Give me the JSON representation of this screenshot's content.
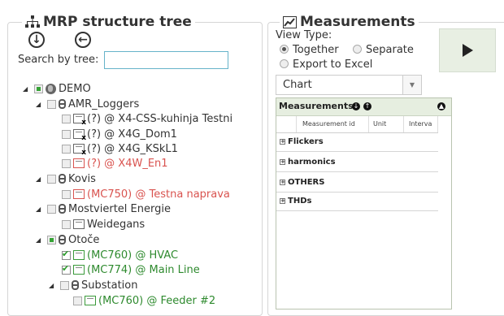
{
  "left_panel": {
    "title": "MRP structure tree",
    "search_label": "Search by tree:",
    "search_value": "",
    "tree": [
      {
        "label": "DEMO",
        "level": 0,
        "expanded": true,
        "checkbox": "partial",
        "icon": "globe-icon",
        "color": "normal"
      },
      {
        "label": "AMR_Loggers",
        "level": 1,
        "expanded": true,
        "checkbox": "none",
        "icon": "chain-icon",
        "color": "normal"
      },
      {
        "label": "(?) @ X4-CSS-kuhinja Testni",
        "level": 2,
        "checkbox": "none",
        "icon": "device-offline-icon",
        "color": "normal"
      },
      {
        "label": "(?) @ X4G_Dom1",
        "level": 2,
        "checkbox": "none",
        "icon": "device-offline-icon",
        "color": "normal"
      },
      {
        "label": "(?) @ X4G_KSkL1",
        "level": 2,
        "checkbox": "none",
        "icon": "device-offline-icon",
        "color": "normal"
      },
      {
        "label": "(?) @ X4W_En1",
        "level": 2,
        "checkbox": "none",
        "icon": "device-alarm-icon",
        "color": "red"
      },
      {
        "label": "Kovis",
        "level": 1,
        "expanded": true,
        "checkbox": "none",
        "icon": "chain-icon",
        "color": "normal"
      },
      {
        "label": "(MC750) @ Testna naprava",
        "level": 2,
        "checkbox": "none",
        "icon": "device-alarm-icon",
        "color": "red"
      },
      {
        "label": "Mostviertel Energie",
        "level": 1,
        "expanded": true,
        "checkbox": "none",
        "icon": "chain-icon",
        "color": "normal"
      },
      {
        "label": "Weidegans",
        "level": 2,
        "checkbox": "none",
        "icon": "device-icon",
        "color": "normal"
      },
      {
        "label": "Otoče",
        "level": 1,
        "expanded": true,
        "checkbox": "partial",
        "icon": "chain-icon",
        "color": "normal"
      },
      {
        "label": "(MC760) @ HVAC",
        "level": 2,
        "checkbox": "checked",
        "icon": "device-ok-icon",
        "color": "green"
      },
      {
        "label": "(MC774) @ Main Line",
        "level": 2,
        "checkbox": "checked",
        "icon": "device-ok-icon",
        "color": "green"
      },
      {
        "label": "Substation",
        "level": 2,
        "expanded": true,
        "checkbox": "none",
        "icon": "chain-icon",
        "color": "normal"
      },
      {
        "label": "(MC760) @ Feeder #2",
        "level": 3,
        "checkbox": "none",
        "icon": "device-ok-icon",
        "color": "green"
      }
    ]
  },
  "right_panel": {
    "title": "Measurements",
    "view_type_label": "View Type:",
    "options": [
      {
        "label": "Together",
        "selected": true
      },
      {
        "label": "Separate",
        "selected": false
      },
      {
        "label": "Export to Excel",
        "selected": false
      }
    ],
    "chart_select_value": "Chart",
    "grid": {
      "title": "Measurements",
      "columns": [
        "Measurement id",
        "Unit",
        "Interva"
      ],
      "groups": [
        "Flickers",
        "harmonics",
        "OTHERS",
        "THDs"
      ]
    }
  },
  "colors": {
    "red": "#d9534f",
    "green": "#2e8a2e",
    "play_bg": "#e8efe3",
    "input_border": "#66b3c9"
  }
}
